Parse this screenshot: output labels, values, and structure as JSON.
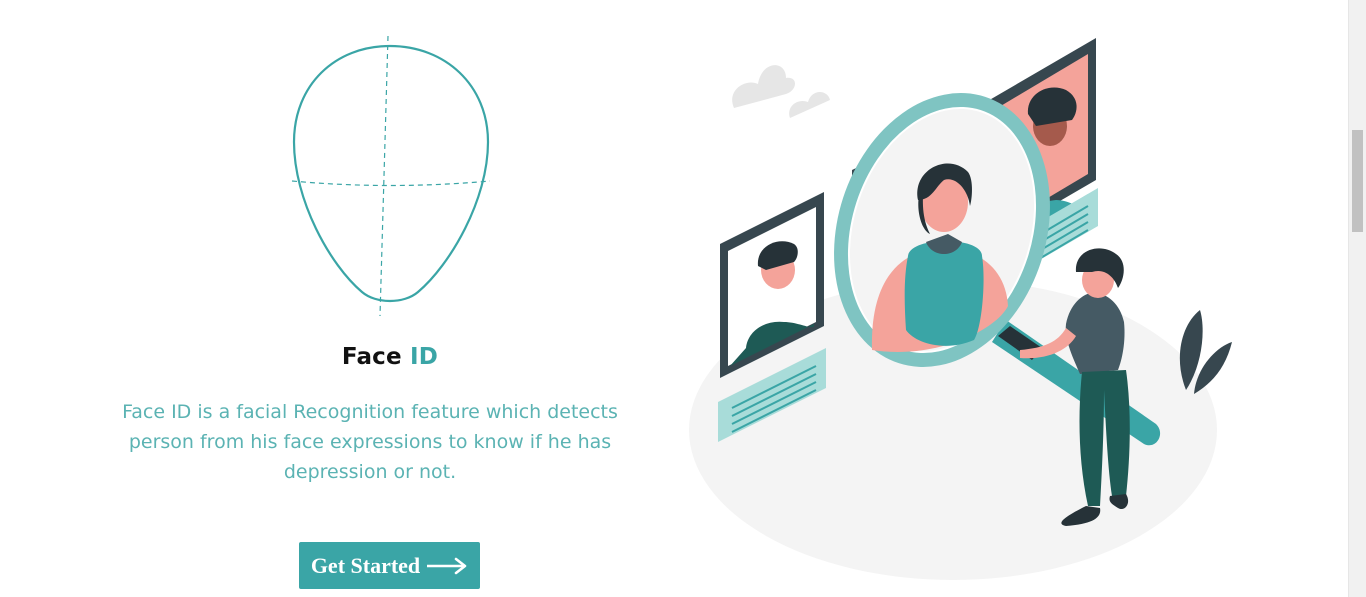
{
  "feature": {
    "title_part1": "Face",
    "title_part2": "ID",
    "description": "Face ID is a facial Recognition feature which detects person from his face expressions to know if he has depression or not.",
    "cta_label": "Get Started"
  },
  "colors": {
    "accent": "#3aa5a6",
    "text_accent": "#5bb3b3",
    "heading": "#111111"
  },
  "icons": {
    "face": "face-outline-icon",
    "arrow": "arrow-right-icon"
  }
}
